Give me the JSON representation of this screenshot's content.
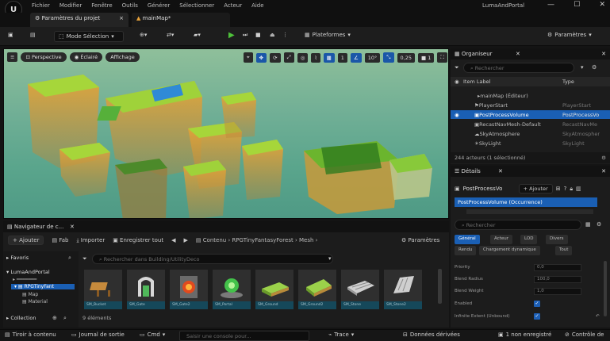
{
  "app": {
    "window_title": "LumaAndPortal",
    "menu": [
      "Fichier",
      "Modifier",
      "Fenêtre",
      "Outils",
      "Générer",
      "Sélectionner",
      "Acteur",
      "Aide"
    ],
    "tabs": [
      {
        "label": "Paramètres du projet",
        "close": "×"
      },
      {
        "label": "mainMap*",
        "close": ""
      }
    ]
  },
  "toolbar": {
    "mode_select": "Mode Sélection",
    "platforms": "Plateformes",
    "settings": "Paramètres"
  },
  "viewport": {
    "perspective": "Perspective",
    "lit": "Éclairé",
    "show": "Affichage",
    "grid_value": "1",
    "angle_value": "10°",
    "scale_value": "0,25",
    "camera_speed": "1"
  },
  "outliner": {
    "title": "Organiseur",
    "search_placeholder": "Rechercher",
    "col_label": "Item Label",
    "col_type": "Type",
    "rows": [
      {
        "label": "mainMap (Éditeur)",
        "type": ""
      },
      {
        "label": "PlayerStart",
        "type": "PlayerStart"
      },
      {
        "label": "PostProcessVolume",
        "type": "PostProcessVo"
      },
      {
        "label": "RecastNavMesh-Default",
        "type": "RecastNavMe"
      },
      {
        "label": "SkyAtmosphere",
        "type": "SkyAtmospher"
      },
      {
        "label": "SkyLight",
        "type": "SkyLight"
      }
    ],
    "footer": "244 acteurs (1 sélectionné)"
  },
  "details": {
    "title": "Détails",
    "actor_name": "PostProcessVo",
    "add_button": "+ Ajouter",
    "component_row": "PostProcessVolume (Occurrence)",
    "search_placeholder": "Rechercher",
    "filters": [
      "Général",
      "Acteur",
      "LOD",
      "Divers",
      "Rendu",
      "Chargement dynamique",
      "Tout"
    ],
    "props": [
      {
        "name": "Priority",
        "value": "0,0"
      },
      {
        "name": "Blend Radius",
        "value": "100,0"
      },
      {
        "name": "Blend Weight",
        "value": "1,0"
      },
      {
        "name": "Enabled",
        "value": ""
      },
      {
        "name": "Infinite Extent (Unbound)",
        "value": ""
      }
    ]
  },
  "content_browser": {
    "title": "Navigateur de c...",
    "add": "+ Ajouter",
    "fab": "Fab",
    "import": "Importer",
    "save_all": "Enregistrer tout",
    "breadcrumb": [
      "Contenu",
      "RPGTinyFantasyForest",
      "Mesh"
    ],
    "settings": "Paramètres",
    "favorites": "Favoris",
    "tree": [
      "LumaAndPortal",
      "RPGTinyFant",
      "Map",
      "Material"
    ],
    "collections": "Collection",
    "search_placeholder": "Rechercher dans Building/UtilityDeco",
    "items_count": "9 éléments",
    "assets": [
      {
        "label": "SM_Bucket",
        "color": "#c68a3c"
      },
      {
        "label": "SM_Gate",
        "color": "#d8d8d8"
      },
      {
        "label": "SM_Gate2",
        "color": "#e04a1e"
      },
      {
        "label": "SM_Portal",
        "color": "#43c24a"
      },
      {
        "label": "SM_Ground",
        "color": "#9bd14a"
      },
      {
        "label": "SM_Ground2",
        "color": "#9bd14a"
      },
      {
        "label": "SM_Stone",
        "color": "#cfcfcf"
      },
      {
        "label": "SM_Stone2",
        "color": "#cfcfcf"
      }
    ]
  },
  "statusbar": {
    "drawer": "Tiroir à contenu",
    "log": "Journal de sortie",
    "cmd": "Cmd",
    "cmd_placeholder": "Saisir une console pour...",
    "trace": "Trace",
    "derived": "Données dérivées",
    "saved": "1 non enregistré",
    "source": "Contrôle de"
  }
}
